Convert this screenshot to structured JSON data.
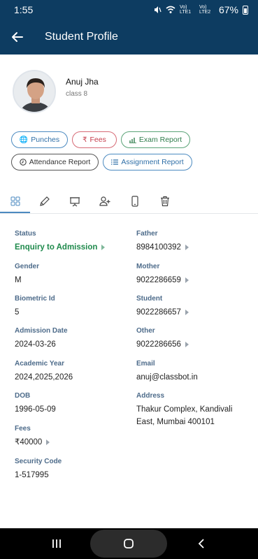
{
  "status_bar": {
    "time": "1:55",
    "network_1": "Vo) LTE1",
    "network_2": "Vo) LTE2",
    "battery": "67%"
  },
  "app_bar": {
    "title": "Student Profile",
    "back_icon": "arrow-left-icon"
  },
  "profile": {
    "name": "Anuj Jha",
    "class": "class 8"
  },
  "chips": [
    {
      "label": "Punches",
      "icon": "globe-icon",
      "color": "#2f6fa7"
    },
    {
      "label": "Fees",
      "icon": "rupee-icon",
      "color": "#c63c4a"
    },
    {
      "label": "Exam Report",
      "icon": "bar-chart-icon",
      "color": "#2f7d4c"
    },
    {
      "label": "Attendance Report",
      "icon": "clock-icon",
      "color": "#333333"
    },
    {
      "label": "Assignment Report",
      "icon": "list-icon",
      "color": "#2f6fa7"
    }
  ],
  "tabs": [
    {
      "icon": "grid-icon",
      "active": true
    },
    {
      "icon": "pencil-icon",
      "active": false
    },
    {
      "icon": "presentation-icon",
      "active": false
    },
    {
      "icon": "add-user-icon",
      "active": false
    },
    {
      "icon": "phone-icon",
      "active": false
    },
    {
      "icon": "trash-icon",
      "active": false
    }
  ],
  "details_left": [
    {
      "label": "Status",
      "value": "Enquiry to Admission"
    },
    {
      "label": "Gender",
      "value": "M"
    },
    {
      "label": "Biometric Id",
      "value": "5"
    },
    {
      "label": "Admission Date",
      "value": "2024-03-26"
    },
    {
      "label": "Academic Year",
      "value": "2024,2025,2026"
    },
    {
      "label": "DOB",
      "value": "1996-05-09"
    },
    {
      "label": "Fees",
      "value": "₹40000"
    },
    {
      "label": "Security Code",
      "value": "1-517995"
    }
  ],
  "details_right": [
    {
      "label": "Father",
      "value": "8984100392"
    },
    {
      "label": "Mother",
      "value": "9022286659"
    },
    {
      "label": "Student",
      "value": "9022286657"
    },
    {
      "label": "Other",
      "value": "9022286656"
    },
    {
      "label": "Email",
      "value": "anuj@classbot.in"
    },
    {
      "label": "Address",
      "value_line1": "Thakur Complex, Kandivali",
      "value_line2": "East, Mumbai 400101"
    }
  ],
  "colors": {
    "primary": "#0d3c61",
    "accent": "#4b8ac0",
    "status_green": "#1f8a4c"
  },
  "nav_bar": {
    "recents_icon": "recents-icon",
    "home_icon": "home-icon",
    "back_icon": "back-chevron-icon"
  }
}
